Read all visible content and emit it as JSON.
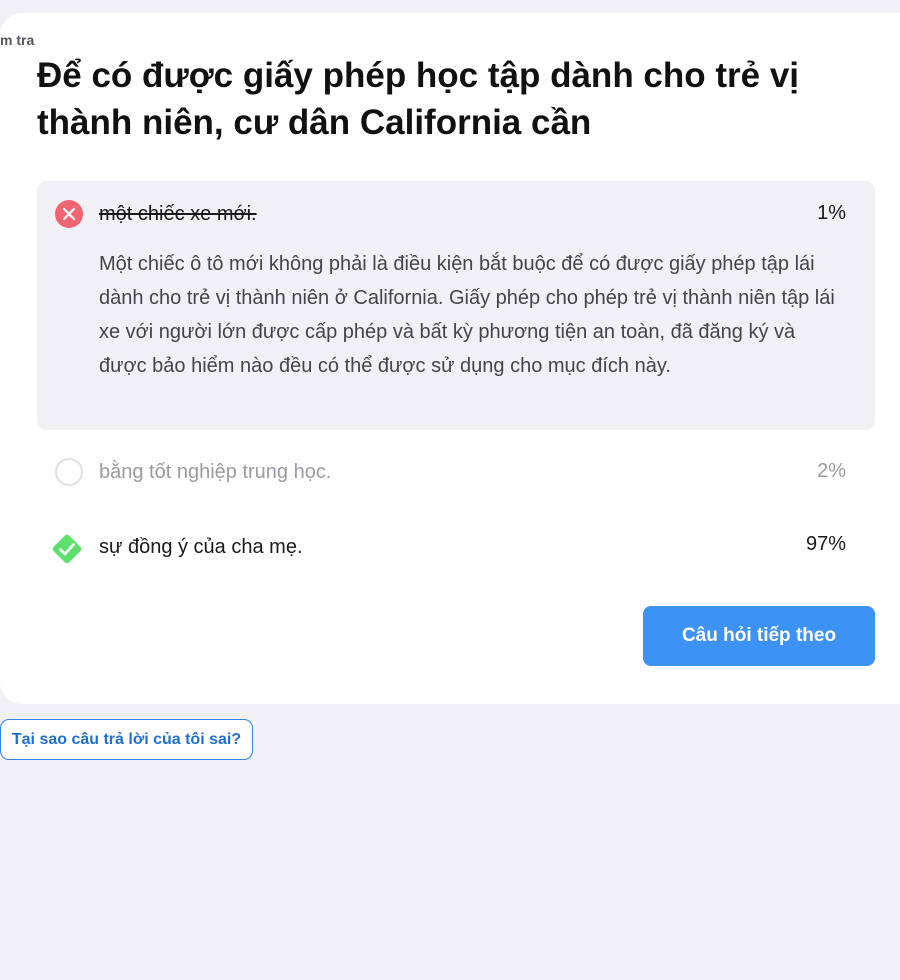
{
  "breadcrumb": "m tra",
  "question": "Để có được giấy phép học tập dành cho trẻ vị thành niên, cư dân California cần",
  "answers": [
    {
      "text": "một chiếc xe mới.",
      "percent": "1%",
      "status": "incorrect-selected",
      "icon": "x-circle-icon",
      "explanation": "Một chiếc ô tô mới không phải là điều kiện bắt buộc để có được giấy phép tập lái dành cho trẻ vị thành niên ở California. Giấy phép cho phép trẻ vị thành niên tập lái xe với người lớn được cấp phép và bất kỳ phương tiện an toàn, đã đăng ký và được bảo hiểm nào đều có thể được sử dụng cho mục đích này."
    },
    {
      "text": "bằng tốt nghiệp trung học.",
      "percent": "2%",
      "status": "unselected",
      "icon": "empty-circle-icon"
    },
    {
      "text": "sự đồng ý của cha mẹ.",
      "percent": "97%",
      "status": "correct",
      "icon": "check-diamond-icon"
    }
  ],
  "next_button": "Câu hỏi tiếp theo",
  "why_button": "Tại sao câu trả lời của tôi sai?",
  "colors": {
    "background": "#f0f0f5",
    "card": "#ffffff",
    "wrong": "#f06473",
    "correct": "#5ee06e",
    "primary": "#3d92f5"
  }
}
